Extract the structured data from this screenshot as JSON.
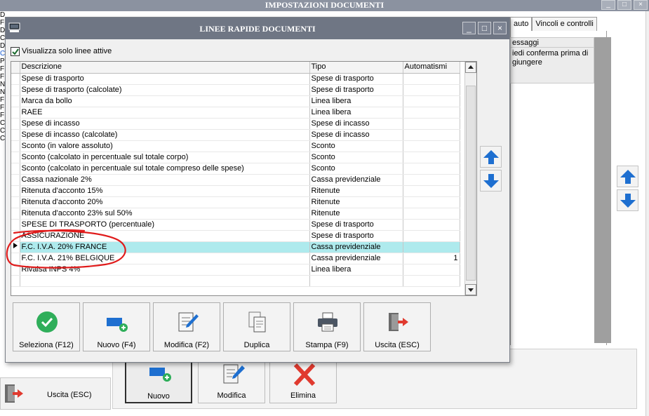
{
  "background": {
    "title": "IMPOSTAZIONI DOCUMENTI",
    "window_controls": [
      "_",
      "□",
      "×"
    ],
    "left_list_letters": [
      "D",
      "F",
      "D",
      "C",
      "D",
      "C",
      "P",
      "F",
      "F",
      "N",
      "N",
      "F",
      "F",
      "F",
      "C",
      "C",
      "C"
    ],
    "tabs": [
      {
        "label": "auto",
        "active": true
      },
      {
        "label": "Vincoli e controlli",
        "active": false
      }
    ],
    "messages_box": {
      "header": "essaggi",
      "body": "iedi conferma prima di giungere"
    },
    "exit_button_label": "Uscita (ESC)",
    "bottom_buttons": [
      {
        "label": "Nuovo",
        "icon": "new-icon",
        "pressed": true
      },
      {
        "label": "Modifica",
        "icon": "edit-icon",
        "pressed": false
      },
      {
        "label": "Elimina",
        "icon": "delete-icon",
        "pressed": false
      }
    ]
  },
  "dialog": {
    "title": "LINEE RAPIDE DOCUMENTI",
    "window_controls": [
      "_",
      "□",
      "×"
    ],
    "checkbox": {
      "label": "Visualizza solo linee attive",
      "checked": true
    },
    "grid": {
      "columns": [
        "Descrizione",
        "Tipo",
        "Automatismi"
      ],
      "selected_index": 15,
      "rows": [
        {
          "descrizione": "Spese di trasporto",
          "tipo": "Spese di trasporto",
          "automatismi": ""
        },
        {
          "descrizione": "Spese di trasporto (calcolate)",
          "tipo": "Spese di trasporto",
          "automatismi": ""
        },
        {
          "descrizione": "Marca da bollo",
          "tipo": "Linea libera",
          "automatismi": ""
        },
        {
          "descrizione": "RAEE",
          "tipo": "Linea libera",
          "automatismi": ""
        },
        {
          "descrizione": "Spese di incasso",
          "tipo": "Spese di incasso",
          "automatismi": ""
        },
        {
          "descrizione": "Spese di incasso (calcolate)",
          "tipo": "Spese di incasso",
          "automatismi": ""
        },
        {
          "descrizione": "Sconto (in valore assoluto)",
          "tipo": "Sconto",
          "automatismi": ""
        },
        {
          "descrizione": "Sconto (calcolato in percentuale sul totale corpo)",
          "tipo": "Sconto",
          "automatismi": ""
        },
        {
          "descrizione": "Sconto (calcolato in percentuale sul totale compreso delle spese)",
          "tipo": "Sconto",
          "automatismi": ""
        },
        {
          "descrizione": "Cassa nazionale 2%",
          "tipo": "Cassa previdenziale",
          "automatismi": ""
        },
        {
          "descrizione": "Ritenuta d'acconto 15%",
          "tipo": "Ritenute",
          "automatismi": ""
        },
        {
          "descrizione": "Ritenuta d'acconto 20%",
          "tipo": "Ritenute",
          "automatismi": ""
        },
        {
          "descrizione": "Ritenuta d'acconto 23% sul 50%",
          "tipo": "Ritenute",
          "automatismi": ""
        },
        {
          "descrizione": "SPESE DI TRASPORTO (percentuale)",
          "tipo": "Spese di trasporto",
          "automatismi": ""
        },
        {
          "descrizione": "ASSICURAZIONE",
          "tipo": "Spese di trasporto",
          "automatismi": ""
        },
        {
          "descrizione": "F.C. I.V.A. 20% FRANCE",
          "tipo": "Cassa previdenziale",
          "automatismi": ""
        },
        {
          "descrizione": "F.C. I.V.A. 21% BELGIQUE",
          "tipo": "Cassa previdenziale",
          "automatismi": "1"
        },
        {
          "descrizione": "Rivalsa INPS 4%",
          "tipo": "Linea libera",
          "automatismi": ""
        }
      ]
    },
    "buttons": [
      {
        "label": "Seleziona (F12)",
        "icon": "check-circle-icon"
      },
      {
        "label": "Nuovo (F4)",
        "icon": "new-icon"
      },
      {
        "label": "Modifica (F2)",
        "icon": "edit-icon"
      },
      {
        "label": "Duplica",
        "icon": "duplicate-icon"
      },
      {
        "label": "Stampa (F9)",
        "icon": "print-icon"
      },
      {
        "label": "Uscita (ESC)",
        "icon": "exit-icon"
      }
    ]
  },
  "colors": {
    "titlebar": "#6f7684",
    "selected_row": "#aeeaed",
    "accent_blue": "#1e6fd0",
    "accent_green": "#2fae5a",
    "annotation_red": "#e01b1b"
  }
}
